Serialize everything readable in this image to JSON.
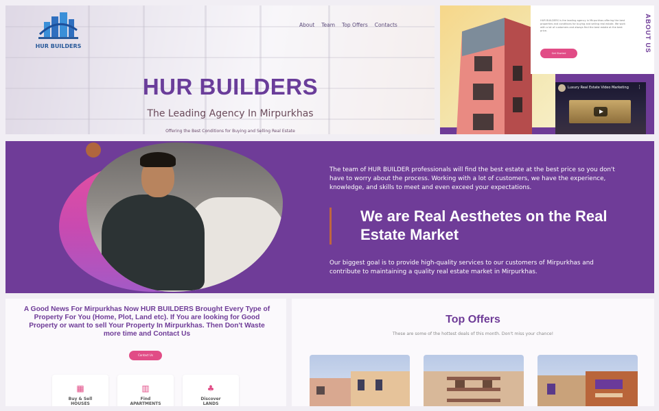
{
  "header": {
    "logo_text": "HUR BUILDERS",
    "nav": [
      "About",
      "Team",
      "Top Offers",
      "Contacts"
    ],
    "title": "HUR BUILDERS",
    "subtitle": "The Leading Agency In Mirpurkhas",
    "tagline": "Offering the Best Conditions for Buying and Selling Real Estate"
  },
  "about": {
    "label": "ABOUT US",
    "card_text": "HUR BUILDERS is the leading agency in Mirpurkhas offering the best properties and conditions for buying and selling real estate. We work with a lot of customers and always find the best estate at the best price.",
    "button": "Get Started",
    "video_title": "Luxury Real Estate Video Marketing"
  },
  "band": {
    "paragraph1": "The team of HUR BUILDER professionals will find the best estate at the best price so you don't have to worry about the process. Working with a lot of customers, we have the experience, knowledge, and skills to meet and even exceed your expectations.",
    "heading": "We are Real Aesthetes on the Real Estate Market",
    "paragraph2": "Our biggest goal is to provide high-quality services to our customers of Mirpurkhas and contribute to maintaining a quality real estate market in Mirpurkhas."
  },
  "news": {
    "text": "A Good News For Mirpurkhas Now HUR BUILDERS Brought Every Type of Property For You (Home, Plot, Land etc). If You are looking for Good Property or want to sell Your Property In Mirpurkhas. Then Don't Waste more time and Contact Us",
    "button": "Contact Us",
    "cards": [
      {
        "icon": "building-icon",
        "line1": "Buy & Sell",
        "line2": "HOUSES"
      },
      {
        "icon": "apartment-icon",
        "line1": "Find",
        "line2": "APARTMENTS"
      },
      {
        "icon": "land-icon",
        "line1": "Discover",
        "line2": "LANDS"
      }
    ]
  },
  "offers": {
    "title": "Top Offers",
    "subtitle": "These are some of the hottest deals of this month. Don't miss your chance!"
  },
  "colors": {
    "primary": "#6e3b97",
    "accent": "#e14c86",
    "band_bar": "#c0663e"
  }
}
